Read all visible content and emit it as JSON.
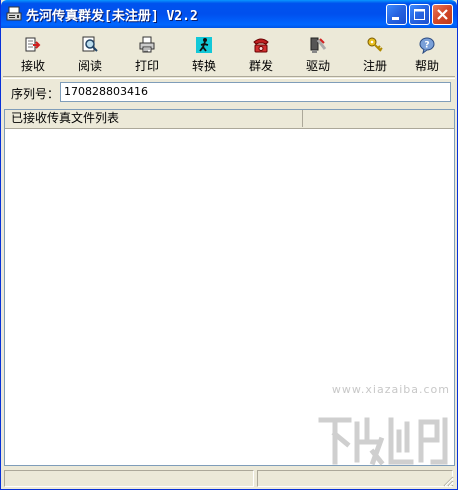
{
  "window": {
    "title": "先河传真群发[未注册] V2.2"
  },
  "toolbar": {
    "items": [
      {
        "label": "接收",
        "icon": "receive-icon"
      },
      {
        "label": "阅读",
        "icon": "read-icon"
      },
      {
        "label": "打印",
        "icon": "printer-icon"
      },
      {
        "label": "转换",
        "icon": "convert-icon"
      },
      {
        "label": "群发",
        "icon": "mass-send-icon"
      },
      {
        "label": "驱动",
        "icon": "driver-icon"
      },
      {
        "label": "注册",
        "icon": "key-icon"
      },
      {
        "label": "帮助",
        "icon": "help-icon"
      }
    ]
  },
  "serial": {
    "label": "序列号：",
    "value": "170828803416"
  },
  "list": {
    "columns": [
      "已接收传真文件列表",
      ""
    ]
  },
  "watermark": {
    "url": "www.xiazaiba.com"
  }
}
